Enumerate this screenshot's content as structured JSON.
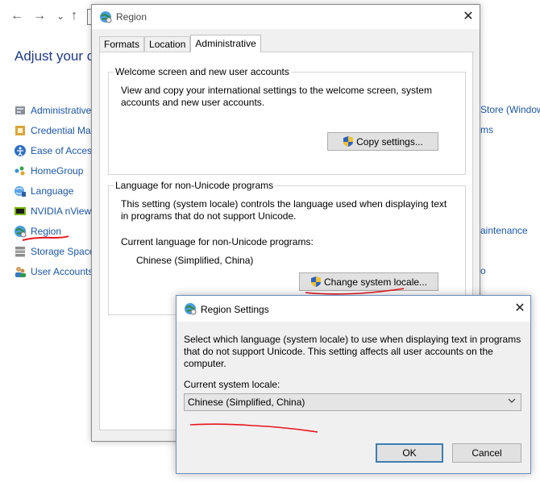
{
  "control_panel": {
    "nav": {
      "back": "←",
      "forward": "→",
      "recent": "⌄",
      "up": "↑"
    },
    "title": "Adjust your co",
    "items": [
      {
        "label": "Administrative",
        "icon": "administrative-tools-icon"
      },
      {
        "label": "Credential Ma",
        "icon": "credential-manager-icon"
      },
      {
        "label": "Ease of Access",
        "icon": "ease-of-access-icon"
      },
      {
        "label": "HomeGroup",
        "icon": "homegroup-icon"
      },
      {
        "label": "Language",
        "icon": "language-icon"
      },
      {
        "label": "NVIDIA nView",
        "icon": "nvidia-nview-icon"
      },
      {
        "label": "Region",
        "icon": "region-icon"
      },
      {
        "label": "Storage Spaces",
        "icon": "storage-spaces-icon"
      },
      {
        "label": "User Accounts",
        "icon": "user-accounts-icon"
      }
    ],
    "right_items": [
      "Store (Window",
      "ms",
      "aintenance",
      "o"
    ]
  },
  "region_dialog": {
    "title": "Region",
    "close": "✕",
    "tabs": [
      "Formats",
      "Location",
      "Administrative"
    ],
    "welcome_group": {
      "title": "Welcome screen and new user accounts",
      "description": "View and copy your international settings to the welcome screen, system accounts and new user accounts.",
      "button": "Copy settings..."
    },
    "unicode_group": {
      "title": "Language for non-Unicode programs",
      "description": "This setting (system locale) controls the language used when displaying text in programs that do not support Unicode.",
      "current_label": "Current language for non-Unicode programs:",
      "current_value": "Chinese (Simplified, China)",
      "button": "Change system locale..."
    }
  },
  "region_settings_dialog": {
    "title": "Region Settings",
    "close": "✕",
    "description": "Select which language (system locale) to use when displaying text in programs that do not support Unicode. This setting affects all user accounts on the computer.",
    "locale_label": "Current system locale:",
    "locale_value": "Chinese (Simplified, China)",
    "ok": "OK",
    "cancel": "Cancel"
  },
  "colors": {
    "link": "#1a56a8",
    "title": "#1e3a8a",
    "annotation": "#e8141b",
    "ok_border": "#3c7fb1"
  }
}
